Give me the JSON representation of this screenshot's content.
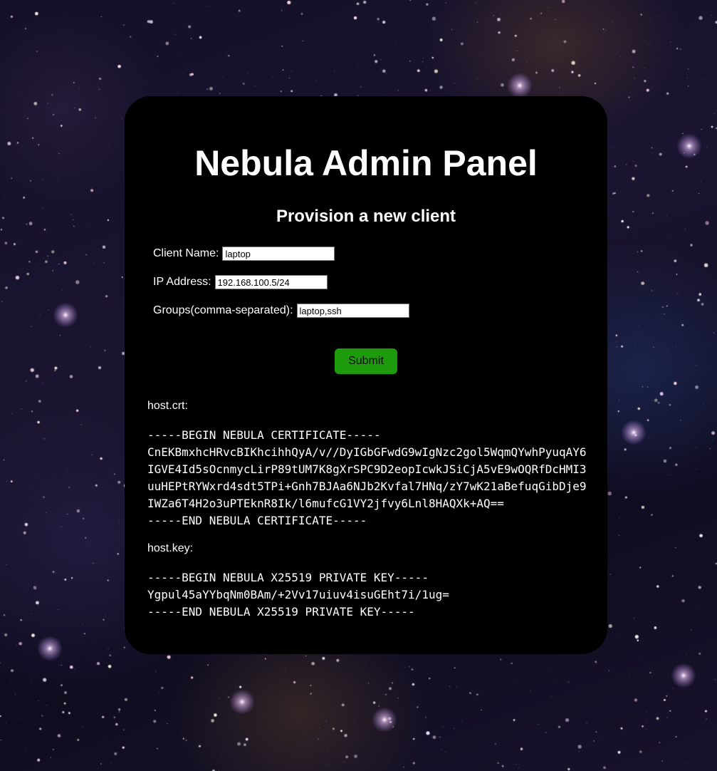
{
  "page": {
    "title": "Nebula Admin Panel",
    "subtitle": "Provision a new client"
  },
  "form": {
    "client_name": {
      "label": "Client Name:",
      "value": "laptop"
    },
    "ip_address": {
      "label": "IP Address:",
      "value": "192.168.100.5/24"
    },
    "groups": {
      "label": "Groups(comma-separated):",
      "value": "laptop,ssh"
    },
    "submit_label": "Submit"
  },
  "output": {
    "cert_label": "host.crt:",
    "cert": "-----BEGIN NEBULA CERTIFICATE-----\nCnEKBmxhcHRvcBIKhcihhQyA/v//DyIGbGFwdG9wIgNzc2gol5WqmQYwhPyuqAY6\nIGVE4Id5sOcnmycLirP89tUM7K8gXrSPC9D2eopIcwkJSiCjA5vE9wOQRfDcHMI3\nuuHEPtRYWxrd4sdt5TPi+Gnh7BJAa6NJb2Kvfal7HNq/zY7wK21aBefuqGibDje9\nIWZa6T4H2o3uPTEknR8Ik/l6mufcG1VY2jfvy6Lnl8HAQXk+AQ==\n-----END NEBULA CERTIFICATE-----",
    "key_label": "host.key:",
    "key": "-----BEGIN NEBULA X25519 PRIVATE KEY-----\nYgpul45aYYbqNm0BAm/+2Vv17uiuv4isuGEht7i/1ug=\n-----END NEBULA X25519 PRIVATE KEY-----"
  },
  "colors": {
    "panel_background": "#000000",
    "submit_button": "#1e9b0c",
    "text": "#ffffff"
  }
}
